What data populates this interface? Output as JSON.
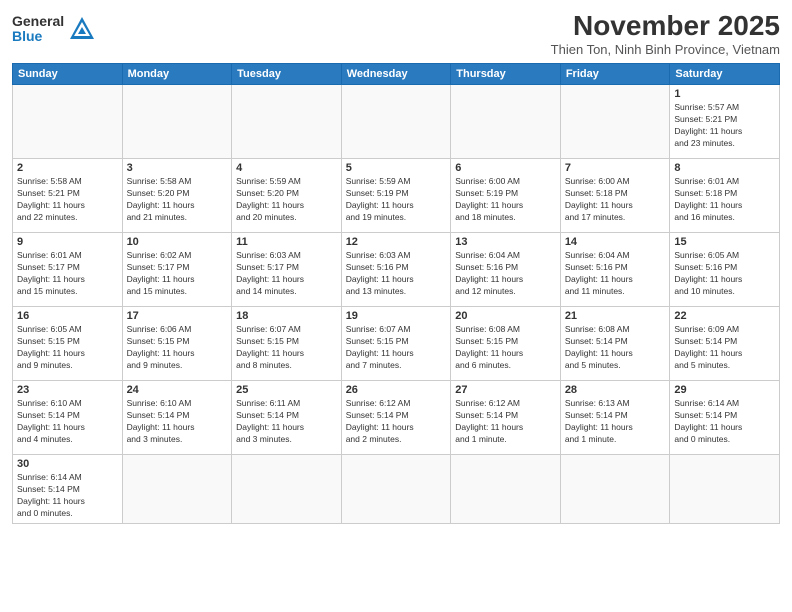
{
  "header": {
    "logo_general": "General",
    "logo_blue": "Blue",
    "month_title": "November 2025",
    "subtitle": "Thien Ton, Ninh Binh Province, Vietnam"
  },
  "weekdays": [
    "Sunday",
    "Monday",
    "Tuesday",
    "Wednesday",
    "Thursday",
    "Friday",
    "Saturday"
  ],
  "weeks": [
    [
      {
        "day": "",
        "info": ""
      },
      {
        "day": "",
        "info": ""
      },
      {
        "day": "",
        "info": ""
      },
      {
        "day": "",
        "info": ""
      },
      {
        "day": "",
        "info": ""
      },
      {
        "day": "",
        "info": ""
      },
      {
        "day": "1",
        "info": "Sunrise: 5:57 AM\nSunset: 5:21 PM\nDaylight: 11 hours\nand 23 minutes."
      }
    ],
    [
      {
        "day": "2",
        "info": "Sunrise: 5:58 AM\nSunset: 5:21 PM\nDaylight: 11 hours\nand 22 minutes."
      },
      {
        "day": "3",
        "info": "Sunrise: 5:58 AM\nSunset: 5:20 PM\nDaylight: 11 hours\nand 21 minutes."
      },
      {
        "day": "4",
        "info": "Sunrise: 5:59 AM\nSunset: 5:20 PM\nDaylight: 11 hours\nand 20 minutes."
      },
      {
        "day": "5",
        "info": "Sunrise: 5:59 AM\nSunset: 5:19 PM\nDaylight: 11 hours\nand 19 minutes."
      },
      {
        "day": "6",
        "info": "Sunrise: 6:00 AM\nSunset: 5:19 PM\nDaylight: 11 hours\nand 18 minutes."
      },
      {
        "day": "7",
        "info": "Sunrise: 6:00 AM\nSunset: 5:18 PM\nDaylight: 11 hours\nand 17 minutes."
      },
      {
        "day": "8",
        "info": "Sunrise: 6:01 AM\nSunset: 5:18 PM\nDaylight: 11 hours\nand 16 minutes."
      }
    ],
    [
      {
        "day": "9",
        "info": "Sunrise: 6:01 AM\nSunset: 5:17 PM\nDaylight: 11 hours\nand 15 minutes."
      },
      {
        "day": "10",
        "info": "Sunrise: 6:02 AM\nSunset: 5:17 PM\nDaylight: 11 hours\nand 15 minutes."
      },
      {
        "day": "11",
        "info": "Sunrise: 6:03 AM\nSunset: 5:17 PM\nDaylight: 11 hours\nand 14 minutes."
      },
      {
        "day": "12",
        "info": "Sunrise: 6:03 AM\nSunset: 5:16 PM\nDaylight: 11 hours\nand 13 minutes."
      },
      {
        "day": "13",
        "info": "Sunrise: 6:04 AM\nSunset: 5:16 PM\nDaylight: 11 hours\nand 12 minutes."
      },
      {
        "day": "14",
        "info": "Sunrise: 6:04 AM\nSunset: 5:16 PM\nDaylight: 11 hours\nand 11 minutes."
      },
      {
        "day": "15",
        "info": "Sunrise: 6:05 AM\nSunset: 5:16 PM\nDaylight: 11 hours\nand 10 minutes."
      }
    ],
    [
      {
        "day": "16",
        "info": "Sunrise: 6:05 AM\nSunset: 5:15 PM\nDaylight: 11 hours\nand 9 minutes."
      },
      {
        "day": "17",
        "info": "Sunrise: 6:06 AM\nSunset: 5:15 PM\nDaylight: 11 hours\nand 9 minutes."
      },
      {
        "day": "18",
        "info": "Sunrise: 6:07 AM\nSunset: 5:15 PM\nDaylight: 11 hours\nand 8 minutes."
      },
      {
        "day": "19",
        "info": "Sunrise: 6:07 AM\nSunset: 5:15 PM\nDaylight: 11 hours\nand 7 minutes."
      },
      {
        "day": "20",
        "info": "Sunrise: 6:08 AM\nSunset: 5:15 PM\nDaylight: 11 hours\nand 6 minutes."
      },
      {
        "day": "21",
        "info": "Sunrise: 6:08 AM\nSunset: 5:14 PM\nDaylight: 11 hours\nand 5 minutes."
      },
      {
        "day": "22",
        "info": "Sunrise: 6:09 AM\nSunset: 5:14 PM\nDaylight: 11 hours\nand 5 minutes."
      }
    ],
    [
      {
        "day": "23",
        "info": "Sunrise: 6:10 AM\nSunset: 5:14 PM\nDaylight: 11 hours\nand 4 minutes."
      },
      {
        "day": "24",
        "info": "Sunrise: 6:10 AM\nSunset: 5:14 PM\nDaylight: 11 hours\nand 3 minutes."
      },
      {
        "day": "25",
        "info": "Sunrise: 6:11 AM\nSunset: 5:14 PM\nDaylight: 11 hours\nand 3 minutes."
      },
      {
        "day": "26",
        "info": "Sunrise: 6:12 AM\nSunset: 5:14 PM\nDaylight: 11 hours\nand 2 minutes."
      },
      {
        "day": "27",
        "info": "Sunrise: 6:12 AM\nSunset: 5:14 PM\nDaylight: 11 hours\nand 1 minute."
      },
      {
        "day": "28",
        "info": "Sunrise: 6:13 AM\nSunset: 5:14 PM\nDaylight: 11 hours\nand 1 minute."
      },
      {
        "day": "29",
        "info": "Sunrise: 6:14 AM\nSunset: 5:14 PM\nDaylight: 11 hours\nand 0 minutes."
      }
    ],
    [
      {
        "day": "30",
        "info": "Sunrise: 6:14 AM\nSunset: 5:14 PM\nDaylight: 11 hours\nand 0 minutes."
      },
      {
        "day": "",
        "info": ""
      },
      {
        "day": "",
        "info": ""
      },
      {
        "day": "",
        "info": ""
      },
      {
        "day": "",
        "info": ""
      },
      {
        "day": "",
        "info": ""
      },
      {
        "day": "",
        "info": ""
      }
    ]
  ]
}
